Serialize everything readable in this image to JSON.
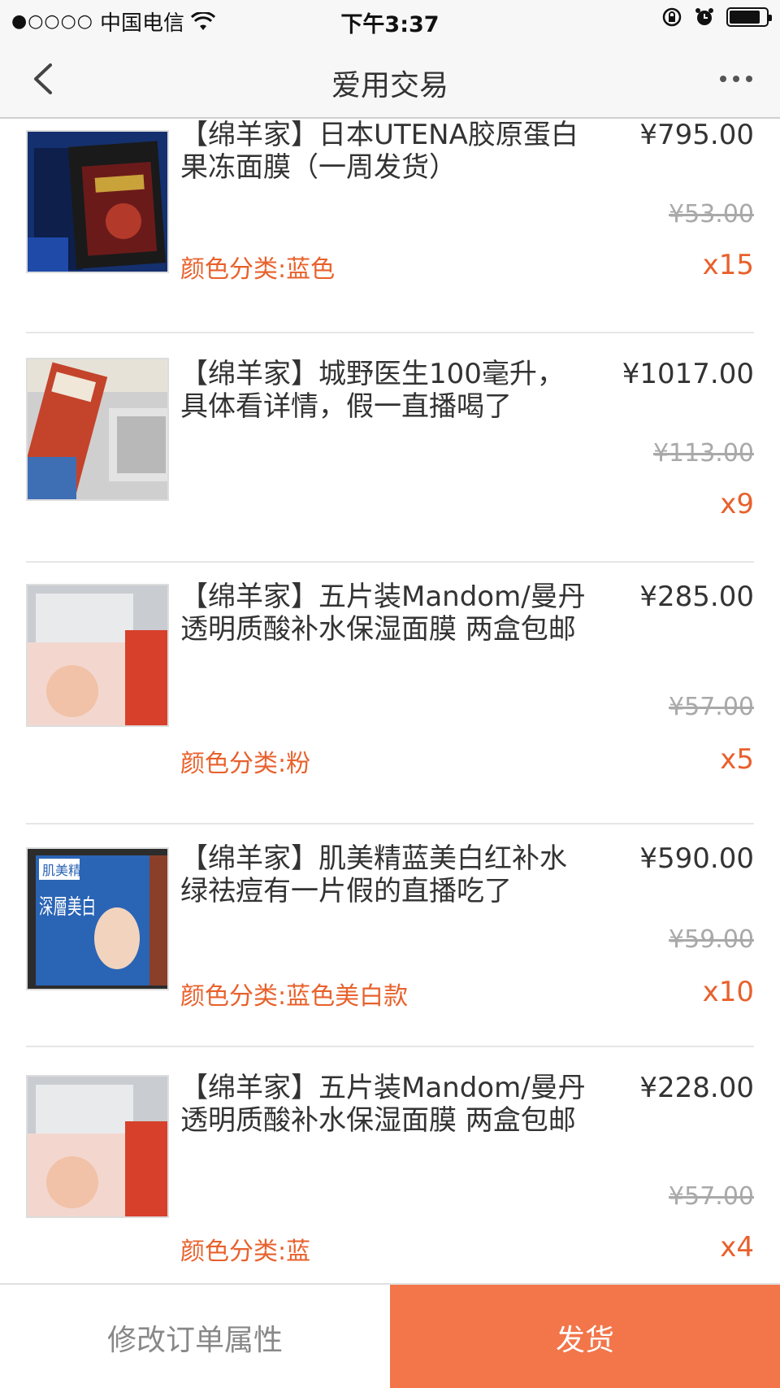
{
  "status_bar": {
    "signal": "●○○○○",
    "carrier": "中国电信",
    "time": "下午3:37"
  },
  "nav": {
    "title": "爱用交易"
  },
  "items": [
    {
      "title": "【绵羊家】日本UTENA胶原蛋白果冻面膜（一周发货）",
      "price": "¥795.00",
      "original_price": "¥53.00",
      "variant": "颜色分类:蓝色",
      "quantity": "x15"
    },
    {
      "title": "【绵羊家】城野医生100毫升，具体看详情，假一直播喝了",
      "price": "¥1017.00",
      "original_price": "¥113.00",
      "variant": "",
      "quantity": "x9"
    },
    {
      "title": "【绵羊家】五片装Mandom/曼丹 透明质酸补水保湿面膜 两盒包邮",
      "price": "¥285.00",
      "original_price": "¥57.00",
      "variant": "颜色分类:粉",
      "quantity": "x5"
    },
    {
      "title": "【绵羊家】肌美精蓝美白红补水绿祛痘有一片假的直播吃了",
      "price": "¥590.00",
      "original_price": "¥59.00",
      "variant": "颜色分类:蓝色美白款",
      "quantity": "x10"
    },
    {
      "title": "【绵羊家】五片装Mandom/曼丹 透明质酸补水保湿面膜 两盒包邮",
      "price": "¥228.00",
      "original_price": "¥57.00",
      "variant": "颜色分类:蓝",
      "quantity": "x4"
    }
  ],
  "thumb_text": {
    "item4_brand": "肌美精",
    "item4_main": "深層美白"
  },
  "bottom_bar": {
    "edit_label": "修改订单属性",
    "ship_label": "发货"
  },
  "colors": {
    "accent": "#f2764a",
    "variant_text": "#e8612c",
    "strike_text": "#a9a9a9"
  },
  "icons": [
    "back-chevron-icon",
    "more-dots-icon",
    "wifi-icon",
    "lock-rotation-icon",
    "alarm-icon",
    "battery-icon"
  ]
}
